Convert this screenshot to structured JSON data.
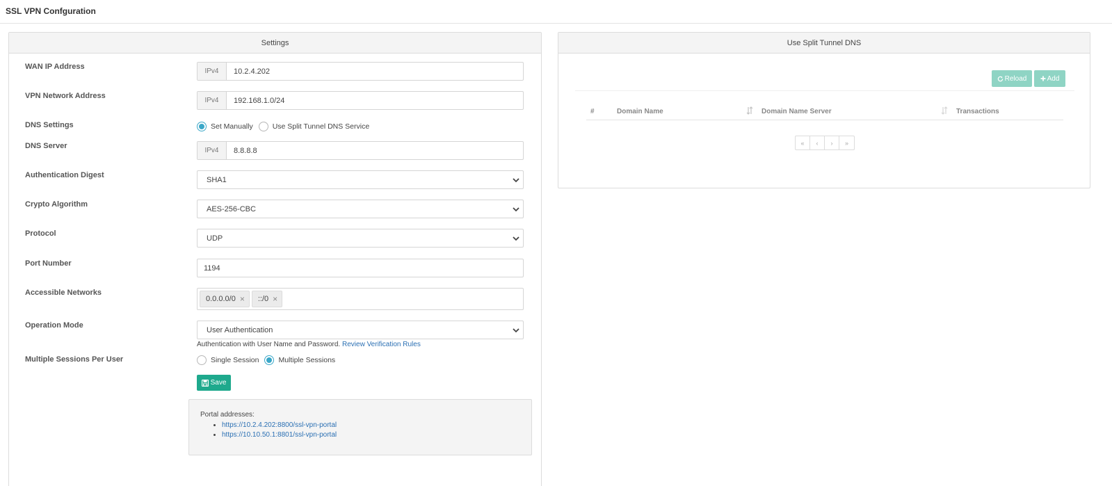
{
  "page": {
    "title": "SSL VPN Confguration"
  },
  "settings": {
    "heading": "Settings",
    "wan_ip": {
      "label": "WAN IP Address",
      "prefix": "IPv4",
      "value": "10.2.4.202"
    },
    "vpn_network": {
      "label": "VPN Network Address",
      "prefix": "IPv4",
      "value": "192.168.1.0/24"
    },
    "dns_settings": {
      "label": "DNS Settings",
      "options": [
        "Set Manually",
        "Use Split Tunnel DNS Service"
      ],
      "selected": "Set Manually"
    },
    "dns_server": {
      "label": "DNS Server",
      "prefix": "IPv4",
      "value": "8.8.8.8"
    },
    "auth_digest": {
      "label": "Authentication Digest",
      "value": "SHA1"
    },
    "crypto": {
      "label": "Crypto Algorithm",
      "value": "AES-256-CBC"
    },
    "protocol": {
      "label": "Protocol",
      "value": "UDP"
    },
    "port": {
      "label": "Port Number",
      "value": "1194"
    },
    "networks": {
      "label": "Accessible Networks",
      "tags": [
        "0.0.0.0/0",
        "::/0"
      ],
      "remove_symbol": "×"
    },
    "operation_mode": {
      "label": "Operation Mode",
      "value": "User Authentication",
      "help_text": "Authentication with User Name and Password.",
      "help_link": "Review Verification Rules"
    },
    "sessions": {
      "label": "Multiple Sessions Per User",
      "options": [
        "Single Session",
        "Multiple Sessions"
      ],
      "selected": "Multiple Sessions"
    },
    "save_label": "Save",
    "portal": {
      "title": "Portal addresses:",
      "links": [
        "https://10.2.4.202:8800/ssl-vpn-portal",
        "https://10.10.50.1:8801/ssl-vpn-portal"
      ]
    }
  },
  "split_dns": {
    "heading": "Use Split Tunnel DNS",
    "reload_label": "Reload",
    "add_label": "Add",
    "columns": [
      "#",
      "Domain Name",
      "Domain Name Server",
      "Transactions"
    ],
    "rows": [],
    "pager": [
      "«",
      "‹",
      "›",
      "»"
    ]
  },
  "colors": {
    "accent": "#1ea98d",
    "radio": "#3aa7c8",
    "link": "#2a6fb3",
    "disabled_button": "#8fd4c4"
  }
}
